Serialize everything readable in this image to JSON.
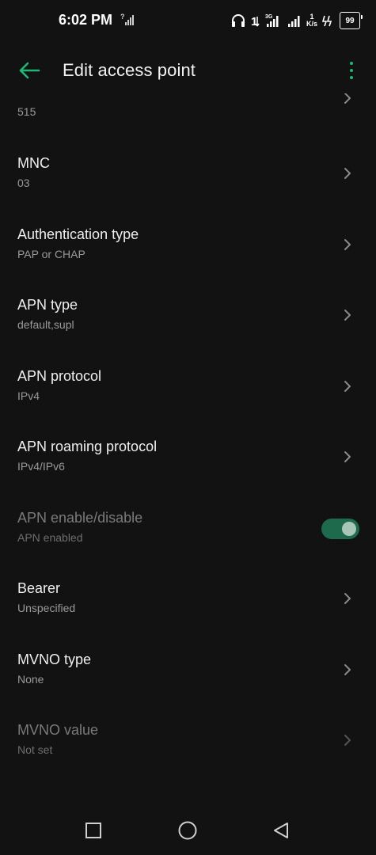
{
  "status_bar": {
    "time": "6:02 PM",
    "net_speed_value": "1",
    "net_speed_unit": "K/s",
    "battery_level": "99",
    "network_type": "3G"
  },
  "app_bar": {
    "title": "Edit access point"
  },
  "colors": {
    "accent": "#1fb777",
    "background": "#121212",
    "toggle_track": "#1e6a4c"
  },
  "list": {
    "partial_item": {
      "value": "515"
    },
    "items": [
      {
        "title": "MNC",
        "value": "03"
      },
      {
        "title": "Authentication type",
        "value": "PAP or CHAP"
      },
      {
        "title": "APN type",
        "value": "default,supl"
      },
      {
        "title": "APN protocol",
        "value": "IPv4"
      },
      {
        "title": "APN roaming protocol",
        "value": "IPv4/IPv6"
      },
      {
        "title": "APN enable/disable",
        "value": "APN enabled",
        "toggle_on": true,
        "disabled": true
      },
      {
        "title": "Bearer",
        "value": "Unspecified"
      },
      {
        "title": "MVNO type",
        "value": "None"
      },
      {
        "title": "MVNO value",
        "value": "Not set",
        "disabled": true
      }
    ]
  },
  "nav_bar": {
    "icons": [
      "recents-square-icon",
      "home-circle-icon",
      "back-triangle-icon"
    ]
  }
}
